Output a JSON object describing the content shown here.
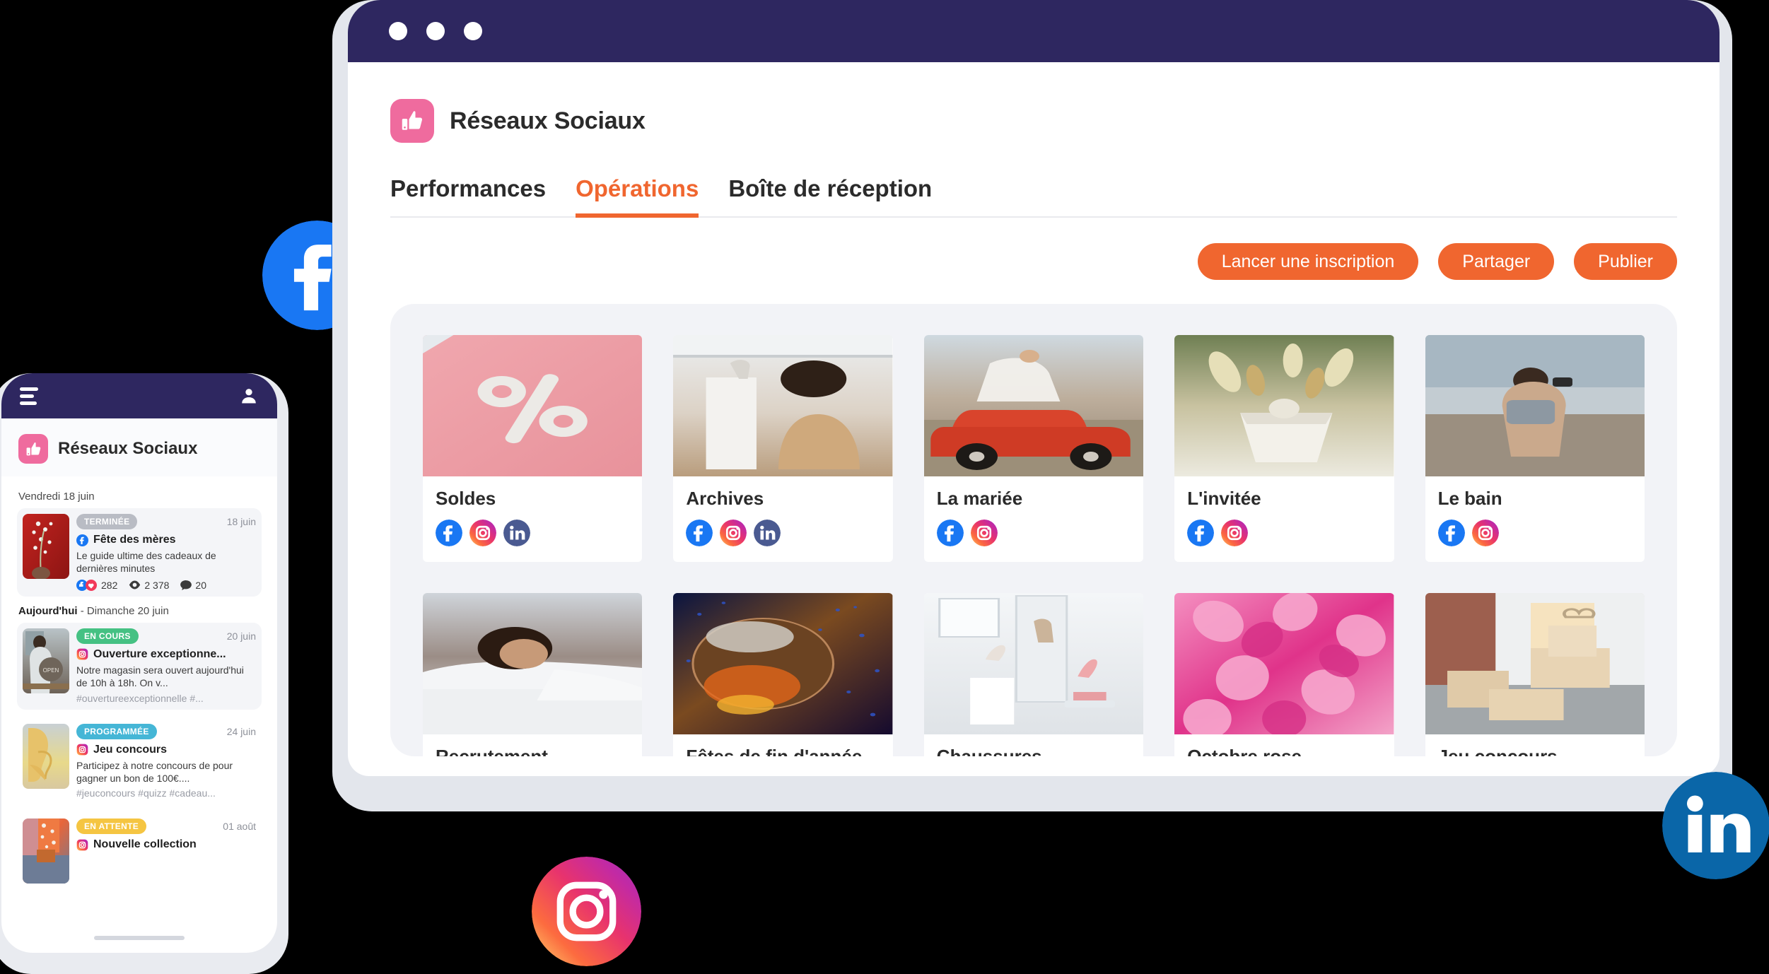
{
  "colors": {
    "header_purple": "#2e2760",
    "accent_orange": "#f0662f",
    "logo_pink": "#ef6b9e",
    "panel_gray": "#f2f3f7",
    "facebook": "#1977f3",
    "linkedin": "#0a66a8",
    "instagram_pink": "#e1306c"
  },
  "browser": {
    "titlebar_dots": [
      "dot-1",
      "dot-2",
      "dot-3"
    ]
  },
  "app": {
    "logo_icon": "thumbs-up-icon",
    "title": "Réseaux Sociaux",
    "tabs": [
      {
        "label": "Performances",
        "active": false
      },
      {
        "label": "Opérations",
        "active": true
      },
      {
        "label": "Boîte de réception",
        "active": false
      }
    ],
    "actions": [
      {
        "label": "Lancer une inscription"
      },
      {
        "label": "Partager"
      },
      {
        "label": "Publier"
      }
    ]
  },
  "grid": {
    "cards": [
      {
        "label": "Soldes",
        "image": "percent-sign-pink",
        "socials": [
          "facebook-icon",
          "instagram-icon",
          "linkedin-icon"
        ]
      },
      {
        "label": "Archives",
        "image": "woman-clothes-rack",
        "socials": [
          "facebook-icon",
          "instagram-icon",
          "linkedin-icon"
        ]
      },
      {
        "label": "La mariée",
        "image": "bride-red-car",
        "socials": [
          "facebook-icon",
          "instagram-icon"
        ]
      },
      {
        "label": "L'invitée",
        "image": "dried-flowers",
        "socials": [
          "facebook-icon",
          "instagram-icon"
        ]
      },
      {
        "label": "Le bain",
        "image": "woman-beach-camera",
        "socials": [
          "facebook-icon",
          "instagram-icon"
        ]
      },
      {
        "label": "Recrutement",
        "image": "woman-resting-bed",
        "socials": []
      },
      {
        "label": "Fêtes de fin d'année",
        "image": "disco-ball",
        "socials": []
      },
      {
        "label": "Chaussures",
        "image": "shoes-showroom",
        "socials": []
      },
      {
        "label": "Octobre rose",
        "image": "pink-hydrangea",
        "socials": []
      },
      {
        "label": "Jeu concours",
        "image": "gift-boxes-doorstep",
        "socials": []
      }
    ]
  },
  "phone": {
    "topbar": {
      "menu_icon": "hamburger-menu-icon",
      "profile_icon": "user-avatar-icon"
    },
    "logo_icon": "thumbs-up-icon",
    "title": "Réseaux Sociaux",
    "groups": [
      {
        "heading_bold": "",
        "heading_rest": "Vendredi 18 juin",
        "posts": [
          {
            "status": "TERMINÉE",
            "status_kind": "done",
            "date": "18 juin",
            "network_icon": "facebook-icon",
            "title": "Fête des mères",
            "text": "Le guide ultime des cadeaux de dernières minutes",
            "tags": "",
            "thumb": "red-fabric-flowers",
            "stats": {
              "reactions": "282",
              "views": "2 378",
              "comments": "20"
            }
          }
        ]
      },
      {
        "heading_bold": "Aujourd'hui",
        "heading_rest": " - Dimanche 20 juin",
        "posts": [
          {
            "status": "EN COURS",
            "status_kind": "live",
            "date": "20 juin",
            "network_icon": "instagram-icon",
            "title": "Ouverture exceptionne...",
            "text": "Notre magasin sera ouvert aujourd'hui de 10h à 18h. On v...",
            "tags": "#ouvertureexceptionnelle #...",
            "thumb": "shop-open-sign",
            "stats": null
          },
          {
            "status": "PROGRAMMÉE",
            "status_kind": "sched",
            "date": "24 juin",
            "network_icon": "instagram-icon",
            "title": "Jeu concours",
            "text": "Participez à notre concours de pour gagner un bon de 100€....",
            "tags": "#jeuconcours #quizz #cadeau...",
            "thumb": "yellow-heel-shoe",
            "stats": null
          },
          {
            "status": "EN ATTENTE",
            "status_kind": "wait",
            "date": "01 août",
            "network_icon": "instagram-icon",
            "title": "Nouvelle collection",
            "text": "",
            "tags": "",
            "thumb": "floral-jacket-outfit",
            "stats": null
          }
        ]
      }
    ]
  },
  "floating_badges": [
    {
      "name": "facebook-badge",
      "icon": "facebook-icon"
    },
    {
      "name": "instagram-badge",
      "icon": "instagram-icon"
    },
    {
      "name": "linkedin-badge",
      "icon": "linkedin-icon"
    }
  ]
}
